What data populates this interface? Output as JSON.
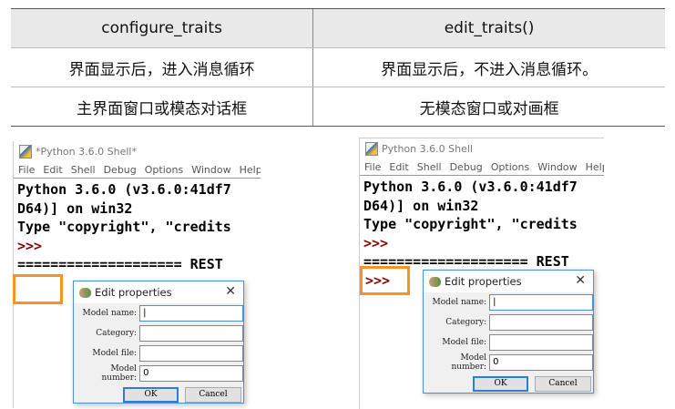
{
  "table": {
    "headers": [
      "configure_traits",
      "edit_traits()"
    ],
    "rows": [
      [
        "界面显示后，进入消息循环",
        "界面显示后，不进入消息循环。"
      ],
      [
        "主界面窗口或模态对话框",
        "无模态窗口或对画框"
      ]
    ]
  },
  "left": {
    "title": "*Python 3.6.0 Shell*",
    "prompt_in_box": ""
  },
  "right": {
    "title": "Python 3.6.0 Shell",
    "prompt_in_box": ">>>"
  },
  "menu": [
    "File",
    "Edit",
    "Shell",
    "Debug",
    "Options",
    "Window",
    "Help"
  ],
  "shell": {
    "line1": "Python 3.6.0 (v3.6.0:41df7",
    "line2": "D64)] on win32",
    "line3": "Type \"copyright\", \"credits",
    "prompt": ">>>",
    "line5": "==================== REST"
  },
  "dialog": {
    "title": "Edit properties",
    "close": "✕",
    "fields": [
      {
        "label": "Model name:",
        "value": ""
      },
      {
        "label": "Category:",
        "value": ""
      },
      {
        "label": "Model file:",
        "value": ""
      },
      {
        "label": "Model number:",
        "value": "0"
      }
    ],
    "ok": "OK",
    "cancel": "Cancel"
  },
  "colors": {
    "highlight": "#f7941d",
    "prompt": "#8b0000",
    "dialog_border": "#4a90d9"
  }
}
